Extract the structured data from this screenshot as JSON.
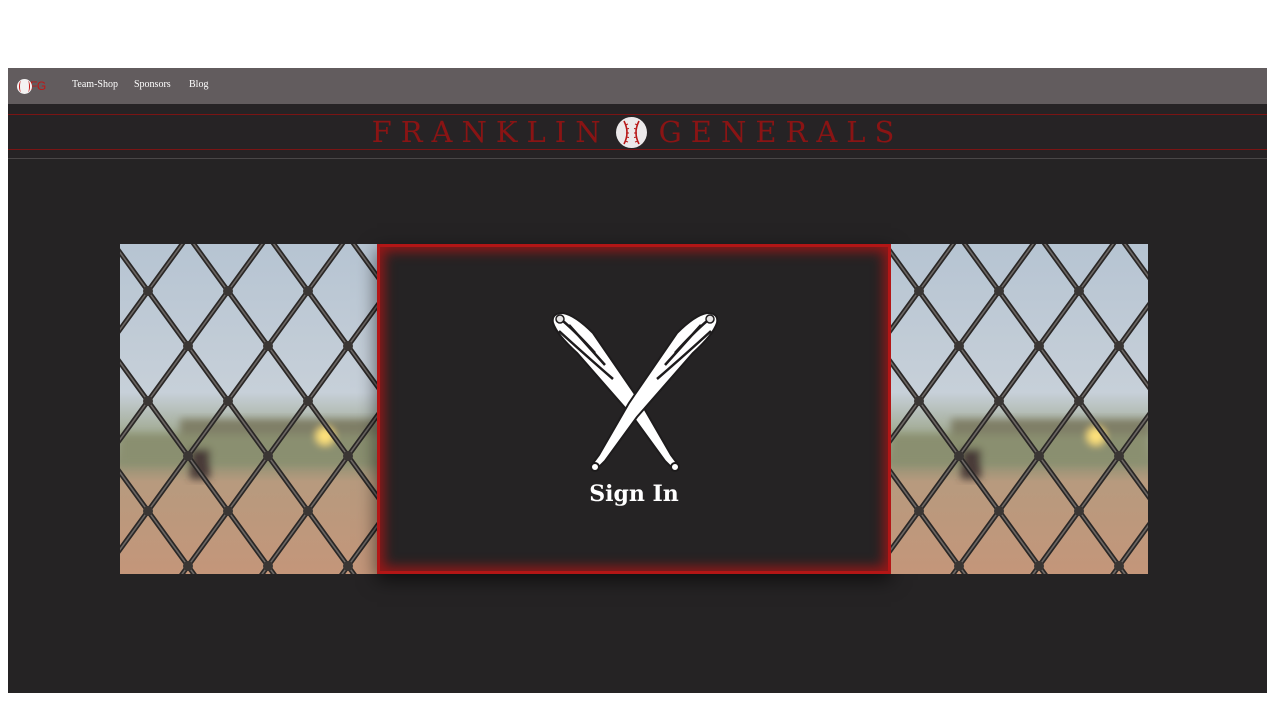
{
  "brand": {
    "logo_text": "FG"
  },
  "nav": {
    "items": [
      {
        "label": "Team-Shop"
      },
      {
        "label": "Sponsors"
      },
      {
        "label": "Blog"
      }
    ]
  },
  "banner": {
    "title_left": "FRANKLIN",
    "title_right": "GENERALS"
  },
  "hero": {
    "signin_label": "Sign In"
  },
  "colors": {
    "page_background": "#252324",
    "navbar": "#625c5e",
    "accent_red": "#b31616",
    "title_red": "#8a1414",
    "text_white": "#ffffff"
  },
  "icons": {
    "brand_logo": "baseball-icon",
    "title_ball": "baseball-icon",
    "signin_graphic": "crossed-bats-icon"
  }
}
